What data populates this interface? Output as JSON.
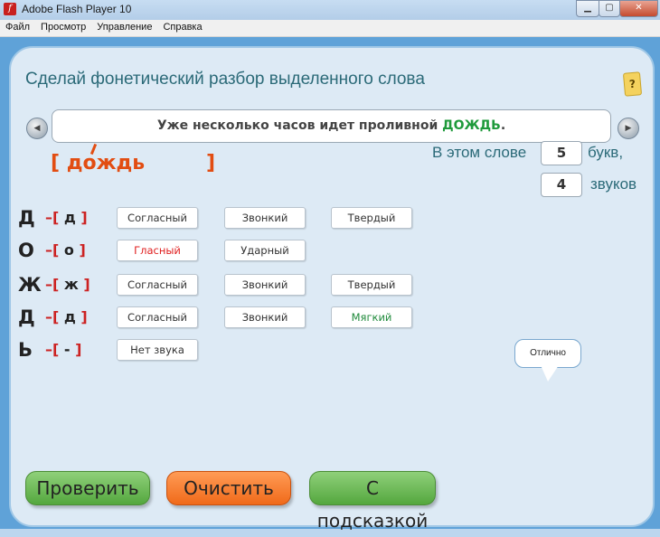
{
  "window": {
    "title": "Adobe Flash Player 10",
    "minimize_glyph": "▁",
    "maximize_glyph": "▢",
    "close_glyph": "✕"
  },
  "menu": [
    "Файл",
    "Просмотр",
    "Управление",
    "Справка"
  ],
  "heading": "Сделай фонетический разбор выделенного слова",
  "help_label": "?",
  "sentence": {
    "before": "Уже несколько часов идет проливной ",
    "word": "ДОЖДЬ",
    "after": "."
  },
  "transcription": {
    "open": "[",
    "word": "дождь",
    "close": "]"
  },
  "counts": {
    "letters_prefix": "В этом слове",
    "letters_value": "5",
    "letters_suffix": "букв,",
    "sounds_value": "4",
    "sounds_suffix": "звуков"
  },
  "rows": [
    {
      "letter": "Д",
      "sound": "д",
      "tags": [
        "Согласный",
        "Звонкий",
        "Твердый"
      ]
    },
    {
      "letter": "О",
      "sound": "о",
      "tags": [
        "Гласный",
        "Ударный"
      ]
    },
    {
      "letter": "Ж",
      "sound": "ж",
      "tags": [
        "Согласный",
        "Звонкий",
        "Твердый"
      ]
    },
    {
      "letter": "Д",
      "sound": "д",
      "tags": [
        "Согласный",
        "Звонкий",
        "Мягкий"
      ]
    },
    {
      "letter": "Ь",
      "sound": "-",
      "tags": [
        "Нет звука"
      ]
    }
  ],
  "tag_colors": {
    "Гласный": "#e02020",
    "Мягкий": "#1f8a3b"
  },
  "feedback": "Отлично",
  "buttons": {
    "check": "Проверить",
    "clear": "Очистить",
    "hint": "С подсказкой"
  },
  "colors": {
    "stage": "#5fa2d8",
    "panel": "#ddeaf5",
    "heading": "#2b6a78",
    "accent_orange": "#e24d12",
    "button_green": "#6bbd55",
    "button_orange": "#f57a2a"
  }
}
